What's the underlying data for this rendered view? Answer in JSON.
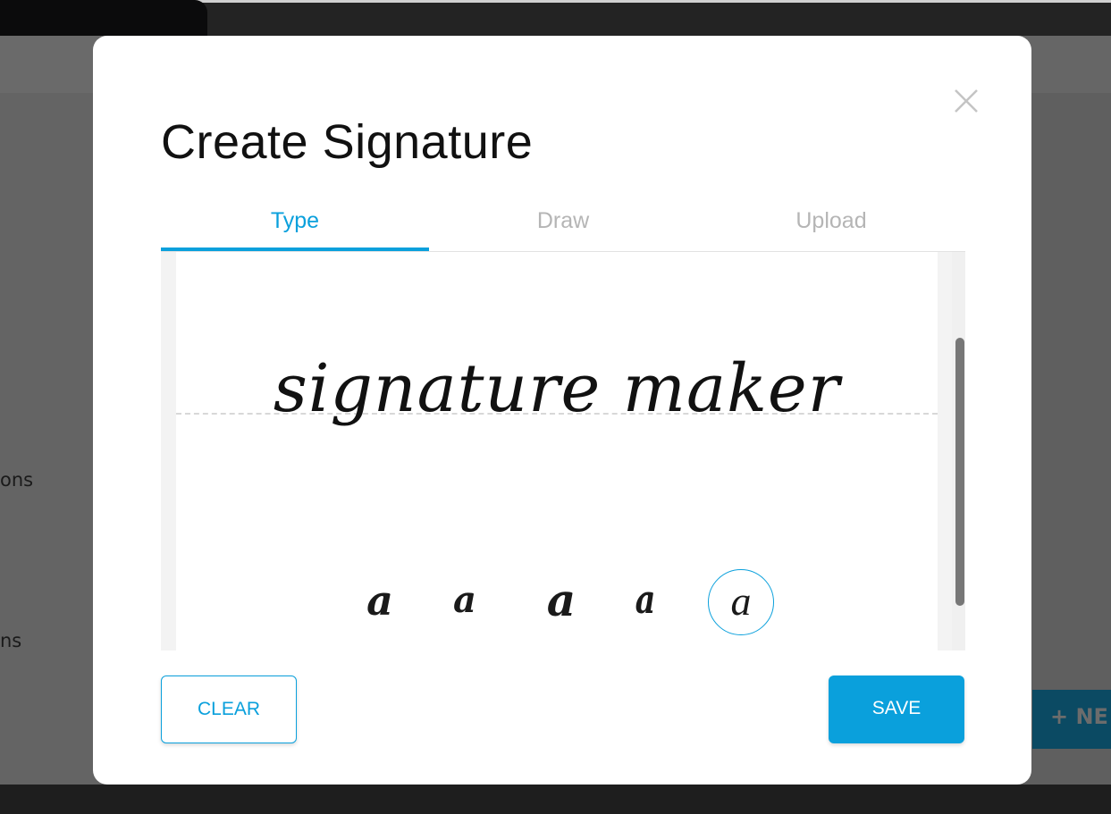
{
  "background": {
    "sidebar_fragments": [
      "ons",
      "ns"
    ],
    "new_button_label": "+ NE"
  },
  "modal": {
    "title": "Create Signature",
    "tabs": [
      {
        "label": "Type",
        "active": true
      },
      {
        "label": "Draw",
        "active": false
      },
      {
        "label": "Upload",
        "active": false
      }
    ],
    "signature_text": "signature maker",
    "font_options": [
      "a",
      "a",
      "a",
      "a",
      "a"
    ],
    "selected_font_index": 4,
    "clear_label": "CLEAR",
    "save_label": "SAVE",
    "accent_color": "#0aa0dc"
  }
}
